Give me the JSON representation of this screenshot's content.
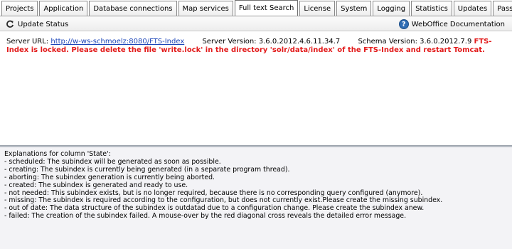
{
  "tabs": [
    {
      "label": "Projects"
    },
    {
      "label": "Application"
    },
    {
      "label": "Database connections"
    },
    {
      "label": "Map services"
    },
    {
      "label": "Full text Search",
      "active": true
    },
    {
      "label": "License"
    },
    {
      "label": "System"
    },
    {
      "label": "Logging"
    },
    {
      "label": "Statistics"
    },
    {
      "label": "Updates"
    },
    {
      "label": "Password"
    }
  ],
  "toolbar": {
    "update_label": "Update Status",
    "update_icon": "refresh-icon",
    "doc_label": "WebOffice Documentation",
    "doc_icon": "help-icon"
  },
  "info": {
    "server_url_label": "Server URL:",
    "server_url": "http://w-ws-schmoelz:8080/FTS-Index",
    "server_version_label": "Server Version:",
    "server_version": "3.6.0.2012.4.6.11.34.7",
    "schema_version_label": "Schema Version:",
    "schema_version": "3.6.0.2012.7.9",
    "error": "FTS-Index is locked. Please delete the file 'write.lock' in the directory 'solr/data/index' of the FTS-Index and restart Tomcat.",
    "error_color": "#e21a1a"
  },
  "explanations": {
    "title": "Explanations for column 'State':",
    "lines": [
      "- scheduled: The subindex will be generated as soon as possible.",
      "- creating: The subindex is currently being generated (in a separate program thread).",
      "- aborting: The subindex generation is currently being aborted.",
      "- created: The subindex is generated and ready to use.",
      "- not needed: This subindex exists, but is no longer required, because there is no corresponding query configured (anymore).",
      "- missing: The subindex is required according to the configuration, but does not currently exist.Please create the missing subindex.",
      "- out of date: The data structure of the subindex is outdatad due to a configuration change. Please create the subindex anew.",
      "- failed: The creation of the subindex failed. A mouse-over by the red diagonal cross reveals the detailed error message."
    ]
  }
}
